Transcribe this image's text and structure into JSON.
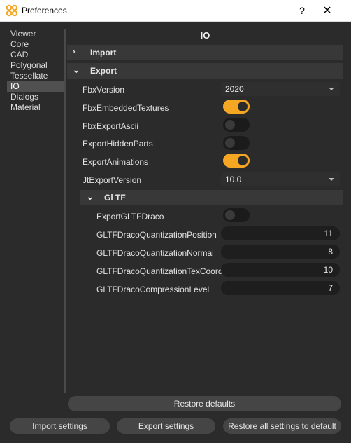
{
  "window": {
    "title": "Preferences",
    "help_glyph": "?",
    "close_glyph": "✕"
  },
  "sidebar": {
    "items": [
      {
        "label": "Viewer"
      },
      {
        "label": "Core"
      },
      {
        "label": "CAD"
      },
      {
        "label": "Polygonal"
      },
      {
        "label": "Tessellate"
      },
      {
        "label": "IO",
        "selected": true
      },
      {
        "label": "Dialogs"
      },
      {
        "label": "Material"
      }
    ]
  },
  "panel": {
    "title": "IO",
    "sections": {
      "import": {
        "label": "Import",
        "expanded": false,
        "chevron": "›"
      },
      "export": {
        "label": "Export",
        "expanded": true,
        "chevron": "⌄"
      },
      "gltf": {
        "label": "Gl TF",
        "expanded": true,
        "chevron": "⌄"
      }
    },
    "export": {
      "fbx_version": {
        "label": "FbxVersion",
        "value": "2020"
      },
      "fbx_embedded_textures": {
        "label": "FbxEmbeddedTextures",
        "on": true
      },
      "fbx_export_ascii": {
        "label": "FbxExportAscii",
        "on": false
      },
      "export_hidden_parts": {
        "label": "ExportHiddenParts",
        "on": false
      },
      "export_animations": {
        "label": "ExportAnimations",
        "on": true
      },
      "jt_export_version": {
        "label": "JtExportVersion",
        "value": "10.0"
      }
    },
    "gltf": {
      "export_gltf_draco": {
        "label": "ExportGLTFDraco",
        "on": false
      },
      "quant_position": {
        "label": "GLTFDracoQuantizationPosition",
        "value": "11"
      },
      "quant_normal": {
        "label": "GLTFDracoQuantizationNormal",
        "value": "8"
      },
      "quant_texcoord": {
        "label": "GLTFDracoQuantizationTexCoord",
        "value": "10"
      },
      "compression_level": {
        "label": "GLTFDracoCompressionLevel",
        "value": "7"
      }
    }
  },
  "buttons": {
    "restore_defaults": "Restore defaults",
    "import_settings": "Import settings",
    "export_settings": "Export settings",
    "restore_all": "Restore all settings to default"
  },
  "colors": {
    "accent": "#f5a623",
    "background": "#2b2b2b",
    "selected": "#505050"
  }
}
